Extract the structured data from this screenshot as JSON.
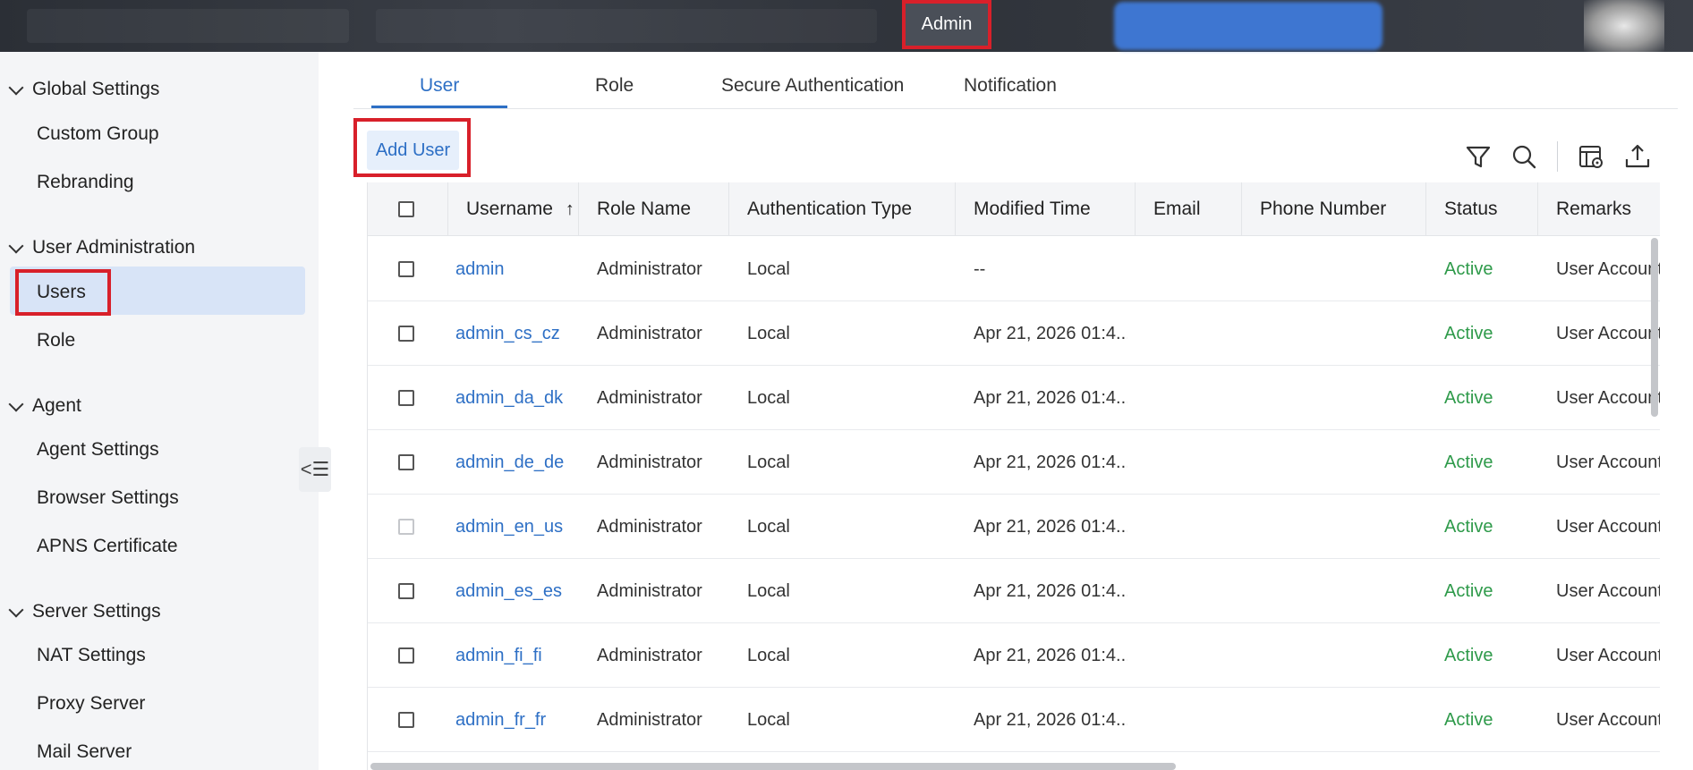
{
  "topbar": {
    "admin_tab": "Admin"
  },
  "sidebar": {
    "sections": [
      {
        "title": "Global Settings",
        "items": [
          "Custom Group",
          "Rebranding"
        ]
      },
      {
        "title": "User Administration",
        "items": [
          "Users",
          "Role"
        ]
      },
      {
        "title": "Agent",
        "items": [
          "Agent Settings",
          "Browser Settings",
          "APNS Certificate"
        ]
      },
      {
        "title": "Server Settings",
        "items": [
          "NAT Settings",
          "Proxy Server",
          "Mail Server"
        ]
      }
    ],
    "collapse_glyph": "<☰"
  },
  "tabs": [
    "User",
    "Role",
    "Secure Authentication",
    "Notification"
  ],
  "toolbar": {
    "add_user": "Add User"
  },
  "table": {
    "columns": [
      "Username",
      "Role Name",
      "Authentication Type",
      "Modified Time",
      "Email",
      "Phone Number",
      "Status",
      "Remarks"
    ],
    "sort_glyph": "↑",
    "rows": [
      {
        "username": "admin",
        "role": "Administrator",
        "auth": "Local",
        "modified": "--",
        "email": "",
        "phone": "",
        "status": "Active",
        "remarks": "User Account"
      },
      {
        "username": "admin_cs_cz",
        "role": "Administrator",
        "auth": "Local",
        "modified": "Apr 21, 2026 01:4...",
        "email": "",
        "phone": "",
        "status": "Active",
        "remarks": "User Account"
      },
      {
        "username": "admin_da_dk",
        "role": "Administrator",
        "auth": "Local",
        "modified": "Apr 21, 2026 01:4...",
        "email": "",
        "phone": "",
        "status": "Active",
        "remarks": "User Account"
      },
      {
        "username": "admin_de_de",
        "role": "Administrator",
        "auth": "Local",
        "modified": "Apr 21, 2026 01:4...",
        "email": "",
        "phone": "",
        "status": "Active",
        "remarks": "User Account"
      },
      {
        "username": "admin_en_us",
        "role": "Administrator",
        "auth": "Local",
        "modified": "Apr 21, 2026 01:4...",
        "email": "",
        "phone": "",
        "status": "Active",
        "remarks": "User Account"
      },
      {
        "username": "admin_es_es",
        "role": "Administrator",
        "auth": "Local",
        "modified": "Apr 21, 2026 01:4...",
        "email": "",
        "phone": "",
        "status": "Active",
        "remarks": "User Account"
      },
      {
        "username": "admin_fi_fi",
        "role": "Administrator",
        "auth": "Local",
        "modified": "Apr 21, 2026 01:4...",
        "email": "",
        "phone": "",
        "status": "Active",
        "remarks": "User Account"
      },
      {
        "username": "admin_fr_fr",
        "role": "Administrator",
        "auth": "Local",
        "modified": "Apr 21, 2026 01:4...",
        "email": "",
        "phone": "",
        "status": "Active",
        "remarks": "User Account"
      }
    ]
  },
  "colors": {
    "accent": "#2d6fc5",
    "status_active": "#2e9a4a",
    "highlight_box": "#d8202a"
  }
}
